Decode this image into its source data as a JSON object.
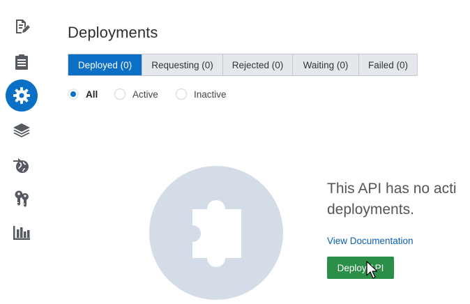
{
  "sidebar": {
    "items": [
      {
        "icon": "edit-document-icon",
        "active": false
      },
      {
        "icon": "clipboard-list-icon",
        "active": false
      },
      {
        "icon": "gear-icon",
        "active": true
      },
      {
        "icon": "layers-icon",
        "active": false
      },
      {
        "icon": "globe-arrow-icon",
        "active": false
      },
      {
        "icon": "keys-icon",
        "active": false
      },
      {
        "icon": "bar-chart-icon",
        "active": false
      }
    ],
    "active_color": "#0b6fc6",
    "icon_color": "#555a60"
  },
  "page": {
    "title": "Deployments"
  },
  "tabs": [
    {
      "label": "Deployed (0)",
      "active": true
    },
    {
      "label": "Requesting (0)",
      "active": false
    },
    {
      "label": "Rejected (0)",
      "active": false
    },
    {
      "label": "Waiting (0)",
      "active": false
    },
    {
      "label": "Failed (0)",
      "active": false
    }
  ],
  "filter": {
    "options": [
      {
        "label": "All",
        "checked": true
      },
      {
        "label": "Active",
        "checked": false
      },
      {
        "label": "Inactive",
        "checked": false
      }
    ]
  },
  "empty_state": {
    "illustration": "puzzle-piece-icon",
    "message_line1": "This API has no acti",
    "message_line2": "deployments.",
    "link_label": "View Documentation",
    "button_label": "Deploy API"
  },
  "colors": {
    "accent": "#0b6fc6",
    "button_green": "#2b8f4a",
    "link": "#0b5fae"
  }
}
